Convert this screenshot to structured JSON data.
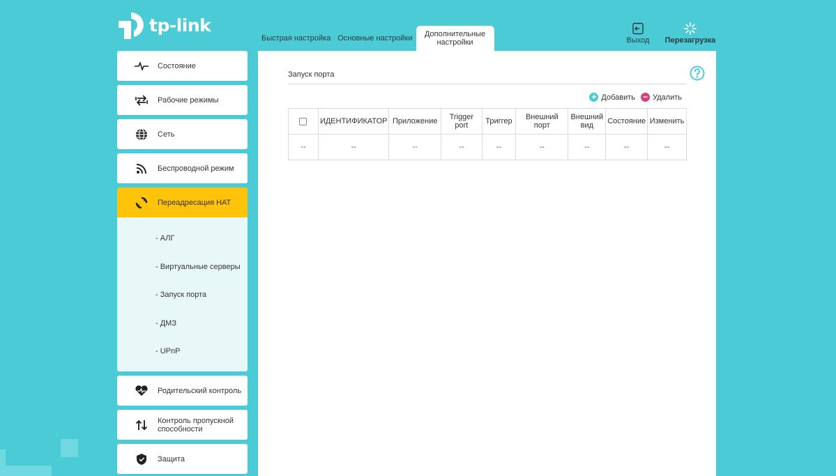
{
  "brand": {
    "name": "tp-link"
  },
  "tabs": [
    {
      "label": "Быстрая настройка"
    },
    {
      "label": "Основные настройки"
    },
    {
      "label": "Дополнительные настройки",
      "active": true
    }
  ],
  "header": {
    "logout_label": "Выход",
    "reboot_label": "Перезагрузка"
  },
  "sidebar": {
    "items": [
      {
        "label": "Состояние",
        "icon": "pulse-icon"
      },
      {
        "label": "Рабочие режимы",
        "icon": "swap-icon"
      },
      {
        "label": "Сеть",
        "icon": "globe-icon"
      },
      {
        "label": "Беспроводной режим",
        "icon": "wifi-icon"
      },
      {
        "label": "Переадресация НАТ",
        "icon": "nat-icon",
        "active": true
      },
      {
        "label": "Родительский контроль",
        "icon": "heart-icon"
      },
      {
        "label": "Контроль пропускной способности",
        "icon": "bandwidth-icon"
      },
      {
        "label": "Защита",
        "icon": "shield-icon"
      }
    ],
    "submenu": [
      {
        "label": "- АЛГ"
      },
      {
        "label": "- Виртуальные серверы"
      },
      {
        "label": "- Запуск порта"
      },
      {
        "label": "- ДМЗ"
      },
      {
        "label": "- UPnP"
      }
    ]
  },
  "main": {
    "section_title": "Запуск порта",
    "add_label": "Добавить",
    "delete_label": "Удалить",
    "table": {
      "columns": [
        "ИДЕНТИФИКАТОР",
        "Приложение",
        "Trigger port",
        "Триггер",
        "Внешний порт",
        "Внешний вид",
        "Состояние",
        "Изменить"
      ],
      "rows": [
        [
          "--",
          "--",
          "--",
          "--",
          "--",
          "--",
          "--",
          "--",
          "--"
        ]
      ]
    }
  },
  "colors": {
    "background": "#4acbd6",
    "active_nav": "#ffc40a",
    "accent": "#4acbd6",
    "delete": "#d2437a"
  }
}
